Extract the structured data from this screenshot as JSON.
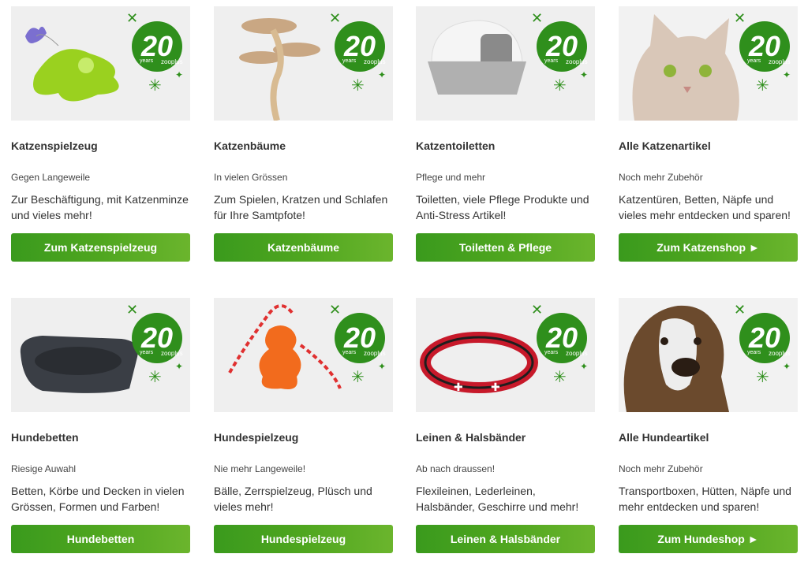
{
  "colors": {
    "button_green": "#4fa61f",
    "badge_green": "#2f8f1c",
    "card_bg": "#efefef"
  },
  "badge": {
    "number": "20",
    "years": "years",
    "brand": "zooplus"
  },
  "cards": [
    {
      "title": "Katzenspielzeug",
      "subtitle": "Gegen Langeweile",
      "description": "Zur Beschäftigung, mit Katzenminze und vieles mehr!",
      "button": "Zum Katzenspielzeug",
      "image": "cat-toy-image"
    },
    {
      "title": "Katzenbäume",
      "subtitle": "In vielen Grössen",
      "description": "Zum Spielen, Kratzen und Schlafen für Ihre Samtpfote!",
      "button": "Katzenbäume",
      "image": "cat-tree-image"
    },
    {
      "title": "Katzentoiletten",
      "subtitle": "Pflege und mehr",
      "description": "Toiletten, viele Pflege Produkte und Anti-Stress Artikel!",
      "button": "Toiletten & Pflege",
      "image": "litter-box-image"
    },
    {
      "title": "Alle Katzenartikel",
      "subtitle": "Noch mehr Zubehör",
      "description": "Katzentüren, Betten, Näpfe und vieles mehr entdecken und sparen!",
      "button": "Zum Katzenshop ►",
      "image": "cat-photo-image"
    },
    {
      "title": "Hundebetten",
      "subtitle": "Riesige Auwahl",
      "description": "Betten, Körbe und Decken in vielen Grössen, Formen und Farben!",
      "button": "Hundebetten",
      "image": "dog-bed-image"
    },
    {
      "title": "Hundespielzeug",
      "subtitle": "Nie mehr Langeweile!",
      "description": "Bälle, Zerrspielzeug, Plüsch und vieles mehr!",
      "button": "Hundespielzeug",
      "image": "dog-toy-image"
    },
    {
      "title": "Leinen & Halsbänder",
      "subtitle": "Ab nach draussen!",
      "description": "Flexileinen, Lederleinen, Halsbänder, Geschirre und mehr!",
      "button": "Leinen & Halsbänder",
      "image": "dog-collar-image"
    },
    {
      "title": "Alle Hundeartikel",
      "subtitle": "Noch mehr Zubehör",
      "description": "Transportboxen, Hütten, Näpfe und mehr entdecken und sparen!",
      "button": "Zum Hundeshop ►",
      "image": "dog-photo-image"
    }
  ]
}
